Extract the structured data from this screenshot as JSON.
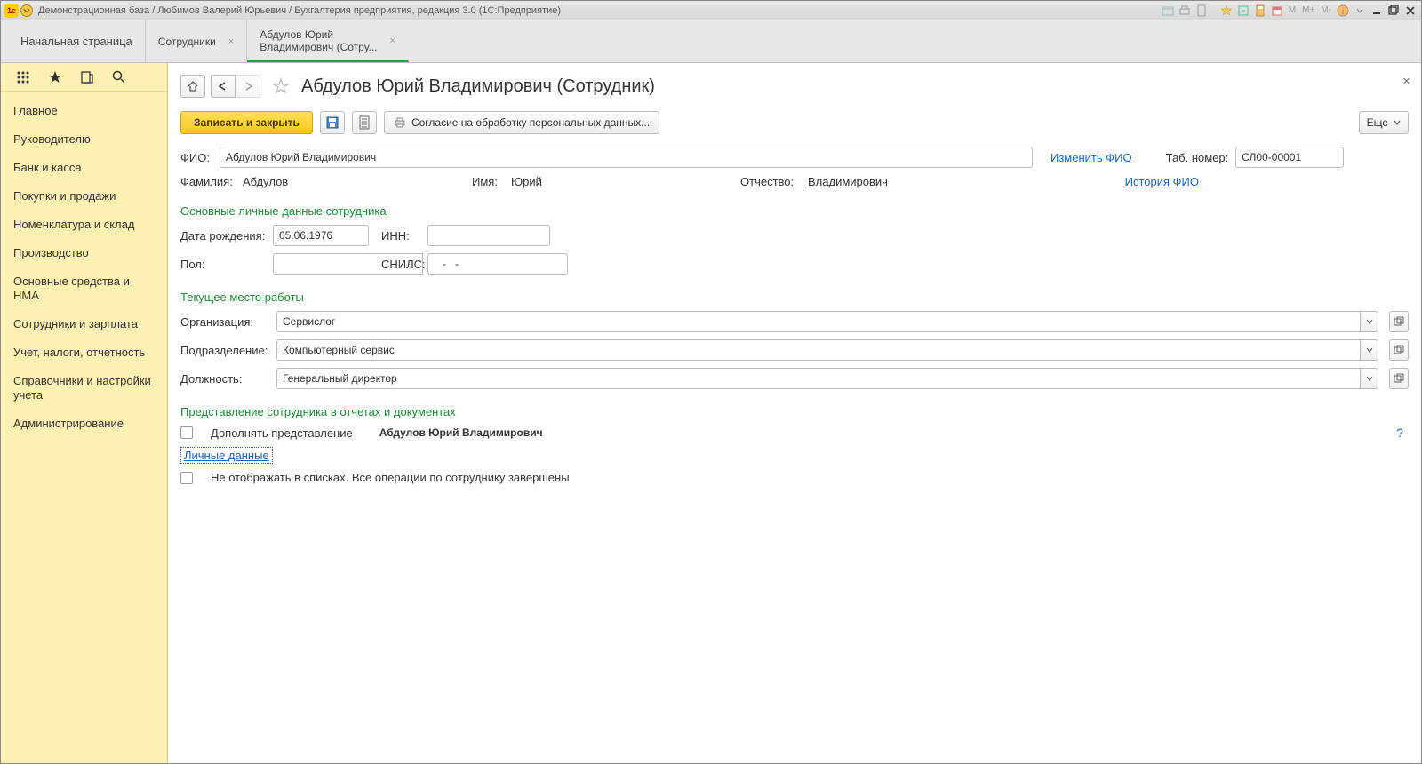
{
  "titlebar": {
    "title": "Демонстрационная база / Любимов Валерий Юрьевич / Бухгалтерия предприятия, редакция 3.0  (1С:Предприятие)",
    "mem": {
      "m": "M",
      "mplus": "M+",
      "mminus": "M-"
    }
  },
  "tabs": {
    "home": "Начальная страница",
    "t1": "Сотрудники",
    "t2_line1": "Абдулов Юрий",
    "t2_line2": "Владимирович (Сотру..."
  },
  "sidebar": {
    "items": [
      "Главное",
      "Руководителю",
      "Банк и касса",
      "Покупки и продажи",
      "Номенклатура и склад",
      "Производство",
      "Основные средства и НМА",
      "Сотрудники и зарплата",
      "Учет, налоги, отчетность",
      "Справочники и настройки учета",
      "Администрирование"
    ]
  },
  "header": {
    "title": "Абдулов Юрий Владимирович (Сотрудник)"
  },
  "cmd": {
    "save_close": "Записать и закрыть",
    "consent": "Согласие на обработку персональных данных...",
    "more": "Еще"
  },
  "form": {
    "fio_label": "ФИО:",
    "fio_value": "Абдулов Юрий Владимирович",
    "change_fio": "Изменить ФИО",
    "tabnum_label": "Таб. номер:",
    "tabnum_value": "СЛ00-00001",
    "surname_label": "Фамилия:",
    "surname_value": "Абдулов",
    "name_label": "Имя:",
    "name_value": "Юрий",
    "patr_label": "Отчество:",
    "patr_value": "Владимирович",
    "history_fio": "История ФИО",
    "sect_personal": "Основные личные данные сотрудника",
    "dob_label": "Дата рождения:",
    "dob_value": "05.06.1976",
    "inn_label": "ИНН:",
    "inn_value": "",
    "sex_label": "Пол:",
    "sex_value": "",
    "snils_label": "СНИЛС:",
    "snils_value": "   -   -",
    "sect_work": "Текущее место работы",
    "org_label": "Организация:",
    "org_value": "Сервислог",
    "dept_label": "Подразделение:",
    "dept_value": "Компьютерный сервис",
    "pos_label": "Должность:",
    "pos_value": "Генеральный директор",
    "sect_repr": "Представление сотрудника в отчетах и документах",
    "repr_check_label": "Дополнять представление",
    "repr_bold": "Абдулов Юрий Владимирович",
    "help": "?",
    "personal_link": "Личные данные",
    "hide_label": "Не отображать в списках. Все операции по сотруднику завершены"
  }
}
